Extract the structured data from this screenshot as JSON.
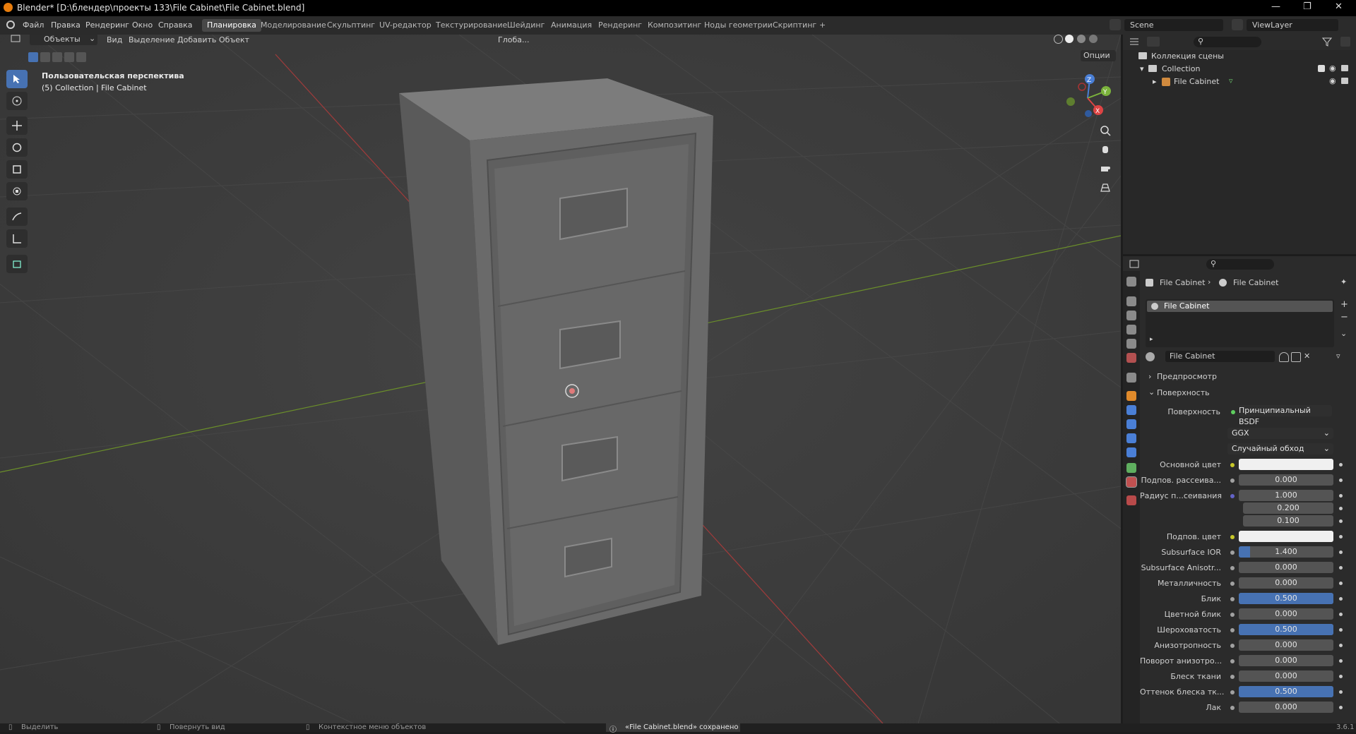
{
  "titlebar": {
    "title": "Blender* [D:\\блендер\\проекты 133\\File Cabinet\\File Cabinet.blend]"
  },
  "menu": {
    "items": [
      "Файл",
      "Правка",
      "Рендеринг",
      "Окно",
      "Справка"
    ]
  },
  "workspaces": {
    "tabs": [
      "Планировка",
      "Моделирование",
      "Скульптинг",
      "UV-редактор",
      "Текстурирование",
      "Шейдинг",
      "Анимация",
      "Рендеринг",
      "Композитинг",
      "Ноды геометрии",
      "Скриптинг"
    ],
    "active": "Планировка",
    "add": "+"
  },
  "scene": {
    "label": "Scene",
    "viewlayer": "ViewLayer"
  },
  "viewport_header": {
    "mode": "Объекты",
    "menus": [
      "Вид",
      "Выделение",
      "Добавить",
      "Объект"
    ],
    "orientation": "Глоба...",
    "options": "Опции"
  },
  "viewport": {
    "perspective": "Пользовательская перспектива",
    "collection_info": "(5) Collection | File Cabinet",
    "gizmo": {
      "z": "Z",
      "y": "Y",
      "x": "X"
    }
  },
  "outliner": {
    "title": "Коллекция сцены",
    "rows": [
      {
        "label": "Collection"
      },
      {
        "label": "File Cabinet"
      }
    ]
  },
  "properties": {
    "breadcrumb": [
      "File Cabinet",
      "File Cabinet"
    ],
    "slot_name": "File Cabinet",
    "material_name": "File Cabinet",
    "panels": {
      "preview": "Предпросмотр",
      "surface": "Поверхность"
    },
    "surface_label": "Поверхность",
    "surface_value": "Принципиальный BSDF",
    "distribution": "GGX",
    "subsurface_method": "Случайный обход",
    "rows": [
      {
        "label": "Основной цвет",
        "type": "color",
        "color": "#f0f0f0",
        "socket": "#c7c729"
      },
      {
        "label": "Подпов. рассеива...",
        "value": "0.000",
        "fill": 0,
        "socket": "#a1a1a1"
      },
      {
        "label": "Радиус п...сеивания",
        "value": "1.000",
        "fill": 0,
        "socket": "#6363c7"
      },
      {
        "label": "",
        "value": "0.200",
        "fill": 0,
        "socket": ""
      },
      {
        "label": "",
        "value": "0.100",
        "fill": 0,
        "socket": ""
      },
      {
        "label": "Подпов. цвет",
        "type": "color",
        "color": "#f0f0f0",
        "socket": "#c7c729"
      },
      {
        "label": "Subsurface IOR",
        "value": "1.400",
        "fill": 0.12,
        "socket": "#a1a1a1"
      },
      {
        "label": "Subsurface Anisotr...",
        "value": "0.000",
        "fill": 0,
        "socket": "#a1a1a1"
      },
      {
        "label": "Металличность",
        "value": "0.000",
        "fill": 0,
        "socket": "#a1a1a1"
      },
      {
        "label": "Блик",
        "value": "0.500",
        "fill": 1,
        "socket": "#a1a1a1"
      },
      {
        "label": "Цветной блик",
        "value": "0.000",
        "fill": 0,
        "socket": "#a1a1a1"
      },
      {
        "label": "Шероховатость",
        "value": "0.500",
        "fill": 1,
        "socket": "#a1a1a1"
      },
      {
        "label": "Анизотропность",
        "value": "0.000",
        "fill": 0,
        "socket": "#a1a1a1"
      },
      {
        "label": "Поворот анизотро...",
        "value": "0.000",
        "fill": 0,
        "socket": "#a1a1a1"
      },
      {
        "label": "Блеск ткани",
        "value": "0.000",
        "fill": 0,
        "socket": "#a1a1a1"
      },
      {
        "label": "Оттенок блеска тк...",
        "value": "0.500",
        "fill": 1,
        "socket": "#a1a1a1"
      },
      {
        "label": "Лак",
        "value": "0.000",
        "fill": 0,
        "socket": "#a1a1a1"
      }
    ]
  },
  "statusbar": {
    "select": "Выделить",
    "rotate": "Повернуть вид",
    "context": "Контекстное меню объектов",
    "saved": "«File Cabinet.blend» сохранено",
    "version": "3.6.1"
  },
  "colors": {
    "accent": "#4772b3",
    "viewport_bg": "#3d3d3d",
    "panel_bg": "#2b2b2b"
  }
}
